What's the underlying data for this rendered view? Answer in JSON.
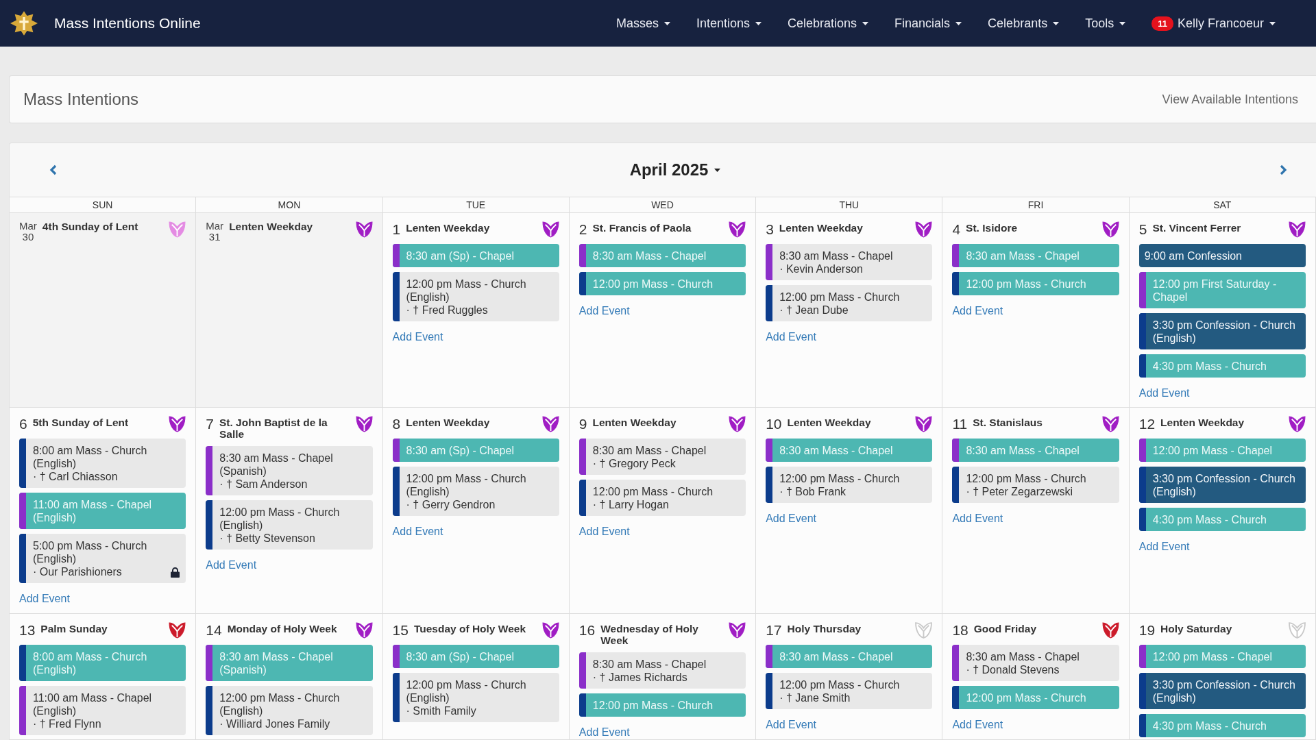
{
  "navbar": {
    "brand": "Mass Intentions Online",
    "menus": [
      "Masses",
      "Intentions",
      "Celebrations",
      "Financials",
      "Celebrants",
      "Tools"
    ],
    "user": {
      "badge": "11",
      "name": "Kelly Francoeur"
    }
  },
  "page_header": {
    "title": "Mass Intentions",
    "link": "View Available Intentions"
  },
  "calendar": {
    "month": "April 2025",
    "weekdays": [
      "SUN",
      "MON",
      "TUE",
      "WED",
      "THU",
      "FRI",
      "SAT"
    ],
    "weeks": [
      {
        "days": [
          {
            "kind": "other_month",
            "month": "Mar",
            "date": "30",
            "title": "4th Sunday of Lent",
            "color": "#e48be3"
          },
          {
            "kind": "other_month",
            "month": "Mar",
            "date": "31",
            "title": "Lenten Weekday",
            "color": "#a01dc4"
          },
          {
            "kind": "current",
            "date": "1",
            "title": "Lenten Weekday",
            "color": "#a01dc4",
            "add_event": "Add Event",
            "events": [
              {
                "kind": "open",
                "color": "#8b2fc9",
                "title": "8:30 am (Sp) - Chapel",
                "locked": false
              },
              {
                "kind": "booked",
                "color": "#0c3c8c",
                "title": "12:00 pm Mass - Church (English)",
                "intention": "· † Fred Ruggles",
                "locked": false
              }
            ]
          },
          {
            "kind": "current",
            "date": "2",
            "title": "St. Francis of Paola",
            "color": "#a01dc4",
            "add_event": "Add Event",
            "events": [
              {
                "kind": "open",
                "color": "#8b2fc9",
                "title": "8:30 am Mass - Chapel",
                "locked": false
              },
              {
                "kind": "open",
                "color": "#0c3c8c",
                "title": "12:00 pm Mass - Church",
                "locked": false
              }
            ]
          },
          {
            "kind": "current",
            "date": "3",
            "title": "Lenten Weekday",
            "color": "#a01dc4",
            "add_event": "Add Event",
            "events": [
              {
                "kind": "booked",
                "color": "#8b2fc9",
                "title": "8:30 am Mass - Chapel",
                "intention": "· Kevin Anderson",
                "locked": false
              },
              {
                "kind": "booked",
                "color": "#0c3c8c",
                "title": "12:00 pm Mass - Church",
                "intention": "· † Jean Dube",
                "locked": false
              }
            ]
          },
          {
            "kind": "current",
            "date": "4",
            "title": "St. Isidore",
            "color": "#a01dc4",
            "add_event": "Add Event",
            "events": [
              {
                "kind": "open",
                "color": "#8b2fc9",
                "title": "8:30 am Mass - Chapel",
                "locked": false
              },
              {
                "kind": "open",
                "color": "#0c3c8c",
                "title": "12:00 pm Mass - Church",
                "locked": false
              }
            ]
          },
          {
            "kind": "current",
            "date": "5",
            "title": "St. Vincent Ferrer",
            "color": "#a01dc4",
            "add_event": "Add Event",
            "events": [
              {
                "kind": "confession",
                "title": "9:00 am Confession",
                "locked": false
              },
              {
                "kind": "open",
                "color": "#8b2fc9",
                "title": "12:00 pm First Saturday - Chapel",
                "locked": false
              },
              {
                "kind": "confession",
                "color": "#0c3c8c",
                "title": "3:30 pm Confession - Church (English)",
                "locked": false
              },
              {
                "kind": "open",
                "color": "#0c3c8c",
                "title": "4:30 pm Mass - Church",
                "locked": false
              }
            ]
          }
        ]
      },
      {
        "days": [
          {
            "kind": "current",
            "date": "6",
            "title": "5th Sunday of Lent",
            "color": "#a01dc4",
            "add_event": "Add Event",
            "events": [
              {
                "kind": "booked",
                "color": "#0c3c8c",
                "title": "8:00 am Mass - Church (English)",
                "intention": "· † Carl Chiasson",
                "locked": false
              },
              {
                "kind": "open",
                "color": "#8b2fc9",
                "title": "11:00 am Mass - Chapel (English)",
                "locked": false
              },
              {
                "kind": "booked",
                "color": "#0c3c8c",
                "title": "5:00 pm Mass - Church (English)",
                "intention": "· Our Parishioners",
                "locked": true
              }
            ]
          },
          {
            "kind": "current",
            "date": "7",
            "title": "St. John Baptist de la Salle",
            "color": "#a01dc4",
            "add_event": "Add Event",
            "events": [
              {
                "kind": "booked",
                "color": "#8b2fc9",
                "title": "8:30 am Mass - Chapel (Spanish)",
                "intention": "· † Sam Anderson",
                "locked": false
              },
              {
                "kind": "booked",
                "color": "#0c3c8c",
                "title": "12:00 pm Mass - Church (English)",
                "intention": "· † Betty Stevenson",
                "locked": false
              }
            ]
          },
          {
            "kind": "current",
            "date": "8",
            "title": "Lenten Weekday",
            "color": "#a01dc4",
            "add_event": "Add Event",
            "events": [
              {
                "kind": "open",
                "color": "#8b2fc9",
                "title": "8:30 am (Sp) - Chapel",
                "locked": false
              },
              {
                "kind": "booked",
                "color": "#0c3c8c",
                "title": "12:00 pm Mass - Church (English)",
                "intention": "· † Gerry Gendron",
                "locked": false
              }
            ]
          },
          {
            "kind": "current",
            "date": "9",
            "title": "Lenten Weekday",
            "color": "#a01dc4",
            "add_event": "Add Event",
            "events": [
              {
                "kind": "booked",
                "color": "#8b2fc9",
                "title": "8:30 am Mass - Chapel",
                "intention": "· † Gregory Peck",
                "locked": false
              },
              {
                "kind": "booked",
                "color": "#0c3c8c",
                "title": "12:00 pm Mass - Church",
                "intention": "· † Larry Hogan",
                "locked": false
              }
            ]
          },
          {
            "kind": "current",
            "date": "10",
            "title": "Lenten Weekday",
            "color": "#a01dc4",
            "add_event": "Add Event",
            "events": [
              {
                "kind": "open",
                "color": "#8b2fc9",
                "title": "8:30 am Mass - Chapel",
                "locked": false
              },
              {
                "kind": "booked",
                "color": "#0c3c8c",
                "title": "12:00 pm Mass - Church",
                "intention": "· † Bob Frank",
                "locked": false
              }
            ]
          },
          {
            "kind": "current",
            "date": "11",
            "title": "St. Stanislaus",
            "color": "#a01dc4",
            "add_event": "Add Event",
            "events": [
              {
                "kind": "open",
                "color": "#8b2fc9",
                "title": "8:30 am Mass - Chapel",
                "locked": false
              },
              {
                "kind": "booked",
                "color": "#0c3c8c",
                "title": "12:00 pm Mass - Church",
                "intention": "· † Peter Zegarzewski",
                "locked": false
              }
            ]
          },
          {
            "kind": "current",
            "date": "12",
            "title": "Lenten Weekday",
            "color": "#a01dc4",
            "add_event": "Add Event",
            "events": [
              {
                "kind": "open",
                "color": "#8b2fc9",
                "title": "12:00 pm Mass - Chapel",
                "locked": false
              },
              {
                "kind": "confession",
                "color": "#0c3c8c",
                "title": "3:30 pm Confession - Church (English)",
                "locked": false
              },
              {
                "kind": "open",
                "color": "#0c3c8c",
                "title": "4:30 pm Mass - Church",
                "locked": false
              }
            ]
          }
        ]
      },
      {
        "days": [
          {
            "kind": "current",
            "date": "13",
            "title": "Palm Sunday",
            "color": "#cc1b2b",
            "events": [
              {
                "kind": "open",
                "color": "#0c3c8c",
                "title": "8:00 am Mass - Church (English)",
                "locked": false
              },
              {
                "kind": "booked",
                "color": "#8b2fc9",
                "title": "11:00 am Mass - Chapel (English)",
                "intention": "· † Fred Flynn",
                "locked": false
              }
            ]
          },
          {
            "kind": "current",
            "date": "14",
            "title": "Monday of Holy Week",
            "color": "#a01dc4",
            "events": [
              {
                "kind": "open",
                "color": "#8b2fc9",
                "title": "8:30 am Mass - Chapel (Spanish)",
                "locked": false
              },
              {
                "kind": "booked",
                "color": "#0c3c8c",
                "title": "12:00 pm Mass - Church (English)",
                "intention": "· Williard Jones Family",
                "locked": false
              }
            ]
          },
          {
            "kind": "current",
            "date": "15",
            "title": "Tuesday of Holy Week",
            "color": "#a01dc4",
            "events": [
              {
                "kind": "open",
                "color": "#8b2fc9",
                "title": "8:30 am (Sp) - Chapel",
                "locked": false
              },
              {
                "kind": "booked",
                "color": "#0c3c8c",
                "title": "12:00 pm Mass - Church (English)",
                "intention": "· Smith Family",
                "locked": false
              }
            ]
          },
          {
            "kind": "current",
            "date": "16",
            "title": "Wednesday of Holy Week",
            "color": "#a01dc4",
            "add_event": "Add Event",
            "events": [
              {
                "kind": "booked",
                "color": "#8b2fc9",
                "title": "8:30 am Mass - Chapel",
                "intention": "· † James Richards",
                "locked": false
              },
              {
                "kind": "open",
                "color": "#0c3c8c",
                "title": "12:00 pm Mass - Church",
                "locked": false
              }
            ]
          },
          {
            "kind": "current",
            "date": "17",
            "title": "Holy Thursday",
            "color": "#c9c9c9",
            "add_event": "Add Event",
            "events": [
              {
                "kind": "open",
                "color": "#8b2fc9",
                "title": "8:30 am Mass - Chapel",
                "locked": false
              },
              {
                "kind": "booked",
                "color": "#0c3c8c",
                "title": "12:00 pm Mass - Church",
                "intention": "· † Jane Smith",
                "locked": false
              }
            ]
          },
          {
            "kind": "current",
            "date": "18",
            "title": "Good Friday",
            "color": "#cc1b2b",
            "add_event": "Add Event",
            "events": [
              {
                "kind": "booked",
                "color": "#8b2fc9",
                "title": "8:30 am Mass - Chapel",
                "intention": "· † Donald Stevens",
                "locked": false
              },
              {
                "kind": "open",
                "color": "#0c3c8c",
                "title": "12:00 pm Mass - Church",
                "locked": false
              }
            ]
          },
          {
            "kind": "current",
            "date": "19",
            "title": "Holy Saturday",
            "color": "#c9c9c9",
            "events": [
              {
                "kind": "open",
                "color": "#8b2fc9",
                "title": "12:00 pm Mass - Chapel",
                "locked": false
              },
              {
                "kind": "confession",
                "color": "#0c3c8c",
                "title": "3:30 pm Confession - Church (English)",
                "locked": false
              },
              {
                "kind": "open",
                "color": "#0c3c8c",
                "title": "4:30 pm Mass - Church",
                "locked": false
              }
            ]
          }
        ]
      }
    ]
  }
}
